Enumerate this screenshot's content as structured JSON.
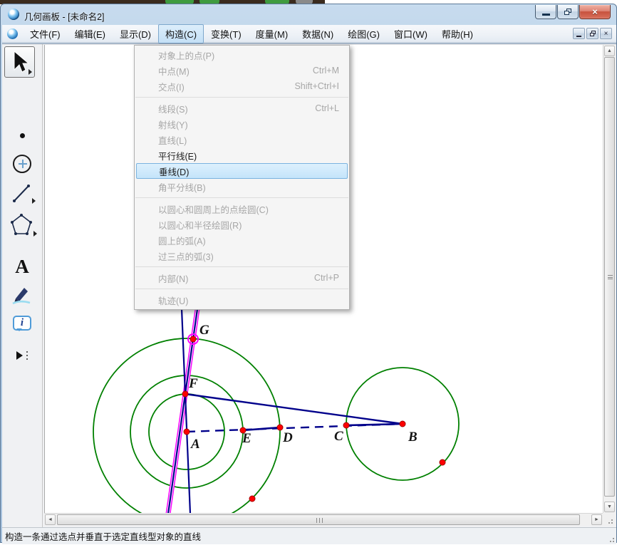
{
  "window": {
    "title": "几何画板 - [未命名2]"
  },
  "menubar": {
    "items": [
      {
        "label": "文件(F)"
      },
      {
        "label": "编辑(E)"
      },
      {
        "label": "显示(D)"
      },
      {
        "label": "构造(C)",
        "state": "active"
      },
      {
        "label": "变换(T)"
      },
      {
        "label": "度量(M)"
      },
      {
        "label": "数据(N)"
      },
      {
        "label": "绘图(G)"
      },
      {
        "label": "窗口(W)"
      },
      {
        "label": "帮助(H)"
      }
    ]
  },
  "construct_menu": {
    "items": [
      {
        "label": "对象上的点(P)",
        "shortcut": "",
        "state": "disabled"
      },
      {
        "label": "中点(M)",
        "shortcut": "Ctrl+M",
        "state": "disabled"
      },
      {
        "label": "交点(I)",
        "shortcut": "Shift+Ctrl+I",
        "state": "disabled"
      },
      {
        "label": "线段(S)",
        "shortcut": "Ctrl+L",
        "state": "disabled"
      },
      {
        "label": "射线(Y)",
        "shortcut": "",
        "state": "disabled"
      },
      {
        "label": "直线(L)",
        "shortcut": "",
        "state": "disabled"
      },
      {
        "label": "平行线(E)",
        "shortcut": "",
        "state": "enabled"
      },
      {
        "label": "垂线(D)",
        "shortcut": "",
        "state": "highlight"
      },
      {
        "label": "角平分线(B)",
        "shortcut": "",
        "state": "disabled"
      },
      {
        "label": "以圆心和圆周上的点绘圆(C)",
        "shortcut": "",
        "state": "disabled"
      },
      {
        "label": "以圆心和半径绘圆(R)",
        "shortcut": "",
        "state": "disabled"
      },
      {
        "label": "圆上的弧(A)",
        "shortcut": "",
        "state": "disabled"
      },
      {
        "label": "过三点的弧(3)",
        "shortcut": "",
        "state": "disabled"
      },
      {
        "label": "内部(N)",
        "shortcut": "Ctrl+P",
        "state": "disabled"
      },
      {
        "label": "轨迹(U)",
        "shortcut": "",
        "state": "disabled"
      }
    ]
  },
  "statusbar": {
    "text": "构造一条通过选点并垂直于选定直线型对象的直线"
  },
  "canvas": {
    "point_labels": [
      "A",
      "B",
      "C",
      "D",
      "E",
      "F",
      "G"
    ]
  },
  "icons": {
    "close": "×",
    "mdi_close": "×",
    "scroll_up": "▲",
    "scroll_down": "▼",
    "scroll_left": "◄",
    "scroll_right": "►",
    "text_tool": "A",
    "info_tool": "i"
  },
  "colors": {
    "circle_green": "#008000",
    "segment_navy": "#00008b",
    "point_red": "#ff0000",
    "selection_magenta": "#ff00ff",
    "menu_highlight": "#c4e4fa",
    "titlebar_blue": "#b0c9e2"
  }
}
